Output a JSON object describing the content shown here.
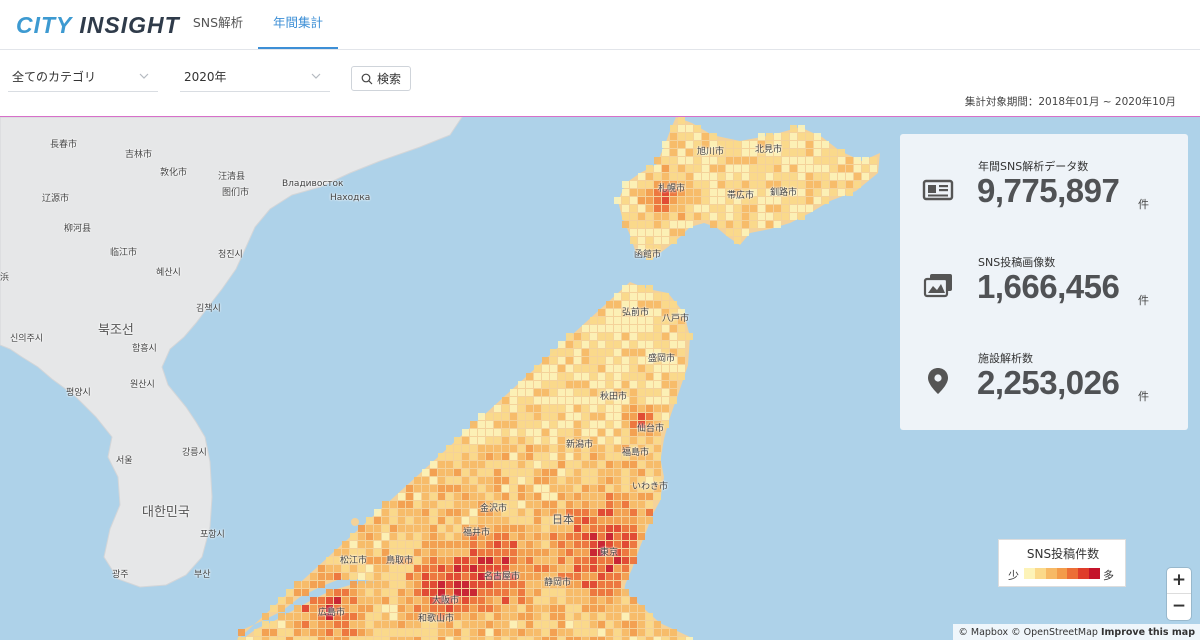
{
  "header": {
    "logo_part1": "CITY",
    "logo_part2": " INSIGHT",
    "tabs": [
      {
        "label": "SNS解析",
        "active": false
      },
      {
        "label": "年間集計",
        "active": true
      }
    ],
    "accent_color": "#3d8fd6"
  },
  "filters": {
    "category": "全てのカテゴリ",
    "year": "2020年",
    "search_label": "検索",
    "period": "集計対象期間：2018年01月 ~ 2020年10月"
  },
  "stats": [
    {
      "title": "年間SNS解析データ数",
      "value": "9,775,897",
      "unit": "件",
      "icon": "document-icon"
    },
    {
      "title": "SNS投稿画像数",
      "value": "1,666,456",
      "unit": "件",
      "icon": "images-icon"
    },
    {
      "title": "施設解析数",
      "value": "2,253,026",
      "unit": "件",
      "icon": "map-pin-icon"
    }
  ],
  "legend": {
    "title": "SNS投稿件数",
    "low": "少",
    "high": "多",
    "colors": [
      "#fdf3b8",
      "#fbd98a",
      "#f7b965",
      "#f39b4a",
      "#ec6e36",
      "#df3d2a",
      "#c4132a"
    ]
  },
  "map": {
    "labels": {
      "chosen_nk": "북조선",
      "korea": "대한민국",
      "japan": "日本",
      "vladivostok": "Владивосток",
      "nakhodka": "Находка",
      "changchun": "長春市",
      "jilin": "吉林市",
      "dunhua": "敦化市",
      "wangqing": "汪清县",
      "tumen": "图们市",
      "liaoyuan": "辽源市",
      "liuhe": "柳河县",
      "linjiang": "临江市",
      "hyesan": "혜산시",
      "chongjin": "청진시",
      "kimchaek": "김책시",
      "hamhung": "함흥시",
      "sinuiju": "신의주시",
      "pyongyang": "평양시",
      "wonsan": "원산시",
      "seoul": "서울",
      "gangneung": "강릉시",
      "pohang": "포항시",
      "gwangju": "광주",
      "busan": "부산",
      "asahikawa": "旭川市",
      "kitami": "北見市",
      "sapporo": "札幌市",
      "obihiro": "帯広市",
      "kushiro": "釧路市",
      "hakodate": "函館市",
      "hirosaki": "弘前市",
      "hachinohe": "八戸市",
      "morioka": "盛岡市",
      "akita": "秋田市",
      "sendai": "仙台市",
      "niigata": "新潟市",
      "fukushima": "福島市",
      "iwaki": "いわき市",
      "kanazawa": "金沢市",
      "fukui": "福井市",
      "tokyo": "東京",
      "matsue": "松江市",
      "tottori": "鳥取市",
      "nagoya": "名古屋市",
      "shizuoka": "静岡市",
      "osaka": "大阪市",
      "hiroshima": "広島市",
      "wakayama": "和歌山市",
      "hamamatsu_stub": "浜"
    }
  },
  "zoom": {
    "in": "+",
    "out": "−"
  },
  "attribution": {
    "text": "© Mapbox © OpenStreetMap",
    "link": "Improve this map"
  }
}
